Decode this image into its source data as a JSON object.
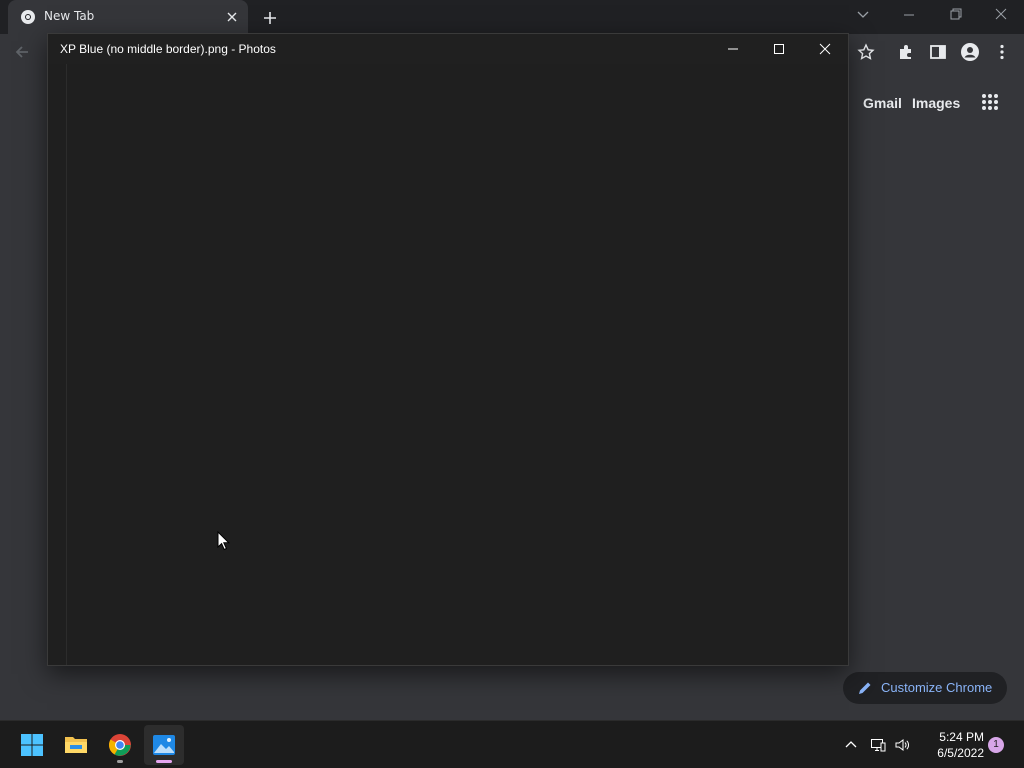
{
  "chrome": {
    "tab_title": "New Tab",
    "ntp_links": {
      "gmail": "Gmail",
      "images": "Images"
    },
    "customize_label": "Customize Chrome",
    "colors": {
      "frame": "#202124",
      "surface": "#35363a",
      "accent": "#8ab4f8"
    }
  },
  "photos": {
    "title": "XP Blue (no middle border).png - Photos"
  },
  "taskbar": {
    "apps": [
      {
        "name": "start-button",
        "icon": "windows-logo-icon"
      },
      {
        "name": "file-explorer",
        "icon": "folder-icon"
      },
      {
        "name": "google-chrome",
        "icon": "chrome-icon"
      },
      {
        "name": "photos",
        "icon": "photos-icon"
      }
    ],
    "time": "5:24 PM",
    "date": "6/5/2022",
    "notification_count": "1"
  }
}
